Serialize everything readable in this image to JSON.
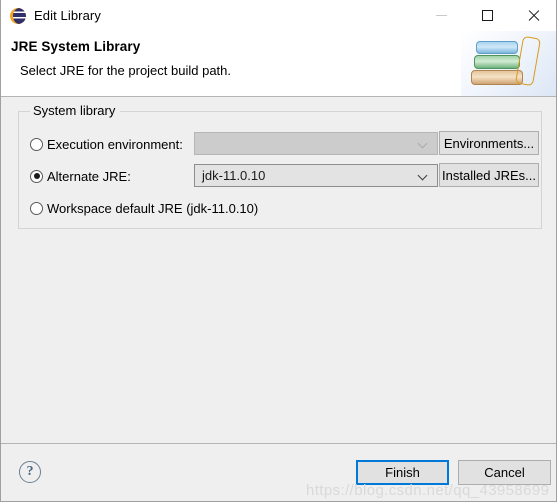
{
  "window": {
    "title": "Edit Library",
    "icon": "eclipse-icon",
    "controls": {
      "minimize": "minimize-icon",
      "maximize": "maximize-icon",
      "close": "close-icon"
    }
  },
  "banner": {
    "title": "JRE System Library",
    "subtitle": "Select JRE for the project build path.",
    "art": "books-stack-icon"
  },
  "group": {
    "label": "System library",
    "options": [
      {
        "label": "Execution environment:",
        "selected": false,
        "value": "",
        "button": "Environments..."
      },
      {
        "label": "Alternate JRE:",
        "selected": true,
        "value": "jdk-11.0.10",
        "button": "Installed JREs..."
      },
      {
        "label": "Workspace default JRE (jdk-11.0.10)",
        "selected": false
      }
    ]
  },
  "footer": {
    "help": "?",
    "finish_label": "Finish",
    "cancel_label": "Cancel"
  },
  "watermark": "https://blog.csdn.net/qq_43958699",
  "colors": {
    "accent": "#0078d7",
    "body_bg": "#efefef",
    "border": "#b4b4b4"
  }
}
